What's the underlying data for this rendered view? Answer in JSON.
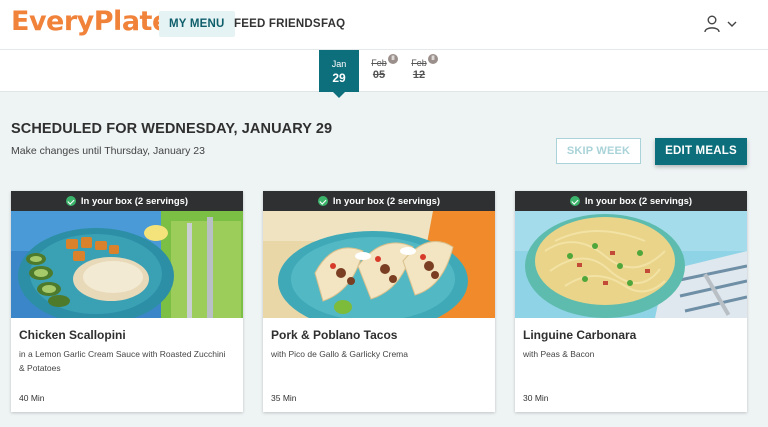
{
  "brand": {
    "name": "EveryPlate",
    "color": "#f0823a"
  },
  "nav": {
    "items": [
      {
        "label": "MY MENU",
        "active": true
      },
      {
        "label": "FEED FRIENDS",
        "active": false
      },
      {
        "label": "FAQ",
        "active": false
      }
    ]
  },
  "header": {
    "user_icon": "user-icon",
    "dropdown_icon": "chevron-down-icon"
  },
  "dates": {
    "active": {
      "month": "Jan",
      "day": "29"
    },
    "others": [
      {
        "month": "Feb",
        "day": "05",
        "status": "paused"
      },
      {
        "month": "Feb",
        "day": "12",
        "status": "paused"
      }
    ],
    "pause_badge": "II"
  },
  "schedule": {
    "title": "SCHEDULED FOR WEDNESDAY, JANUARY 29",
    "subtitle": "Make changes until Thursday, January 23",
    "skip_label": "SKIP WEEK",
    "edit_label": "EDIT MEALS"
  },
  "meals": [
    {
      "badge": "In your box (2 servings)",
      "name": "Chicken Scallopini",
      "description": "in a Lemon Garlic Cream Sauce with Roasted Zucchini & Potatoes",
      "time": "40 Min"
    },
    {
      "badge": "In your box (2 servings)",
      "name": "Pork & Poblano Tacos",
      "description": "with Pico de Gallo & Garlicky Crema",
      "time": "35 Min"
    },
    {
      "badge": "In your box (2 servings)",
      "name": "Linguine Carbonara",
      "description": "with Peas & Bacon",
      "time": "30 Min"
    }
  ],
  "colors": {
    "accent": "#0e6f7c",
    "in_box_check": "#3bb36a",
    "card_bar": "#2e3032"
  }
}
